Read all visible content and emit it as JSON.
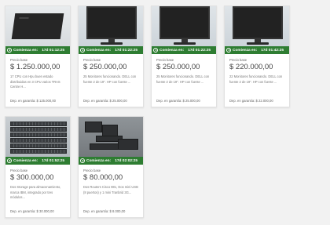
{
  "listing": {
    "countdown_label": "Comienza en:",
    "price_label": "Precio base",
    "deposit_label": "Dep. en garantía:",
    "cards": [
      {
        "image": "desktop-computer",
        "time": "17d 01:12:25",
        "price": "$ 1.250.000,00",
        "description": "17 CPU con Hpu buen estado distribuidas en 3 CPU varios TRAS Centre H...",
        "deposit": "$ 125.000,00"
      },
      {
        "image": "monitor",
        "time": "17d 01:22:25",
        "price": "$ 250.000,00",
        "description": "25 Monitores funcionando. DELL con fuente 2 de 19\". HP con fuente ...",
        "deposit": "$ 25.000,00"
      },
      {
        "image": "monitor",
        "time": "17d 01:22:25",
        "price": "$ 250.000,00",
        "description": "25 Monitores funcionando. DELL con fuente 2 de 19\". HP con fuente ...",
        "deposit": "$ 25.000,00"
      },
      {
        "image": "monitor",
        "time": "17d 01:42:25",
        "price": "$ 220.000,00",
        "description": "22 Monitores funcionando. DELL con fuente 2 de 19\". HP con fuente ...",
        "deposit": "$ 22.000,00"
      },
      {
        "image": "server-racks",
        "time": "17d 01:52:25",
        "price": "$ 300.000,00",
        "description": "Dos Storage para almacenamiento, marca IBM, integrado por tres módulos...",
        "deposit": "$ 30.000,00"
      },
      {
        "image": "routers",
        "time": "17d 02:02:25",
        "price": "$ 80.000,00",
        "description": "Dos Routers Cisco 881, Dos mini USB (8 puertos) y 1 mini Tranbrid 3G...",
        "deposit": "$ 8.000,00"
      }
    ]
  },
  "colors": {
    "badge": "#2e7d32",
    "page_bg": "#f2f2f2"
  }
}
